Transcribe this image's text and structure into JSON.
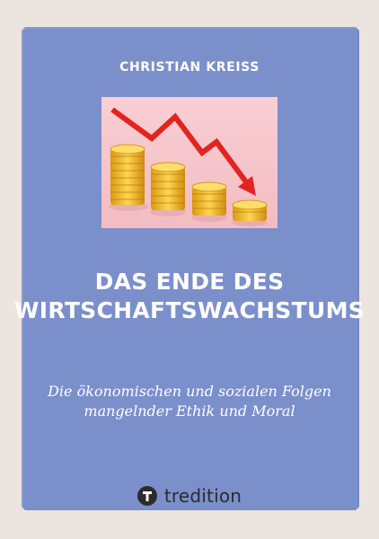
{
  "book": {
    "author": "CHRISTIAN KREISS",
    "title_line1": "DAS ENDE DES",
    "title_line2": "WIRTSCHAFTSWACHSTUMS",
    "subtitle_line1": "Die ökonomischen und sozialen Folgen",
    "subtitle_line2": "mangelnder Ethik und Moral",
    "publisher": "tredition"
  },
  "colors": {
    "page_background": "#ece5df",
    "panel": "#7b8fcb",
    "photo_background": "#f6c7cd",
    "arrow": "#e2231f",
    "coins": "#f2b61f"
  },
  "icons": {
    "cover_image": "coins-with-falling-arrow",
    "publisher_logo": "tredition-logo-icon"
  }
}
